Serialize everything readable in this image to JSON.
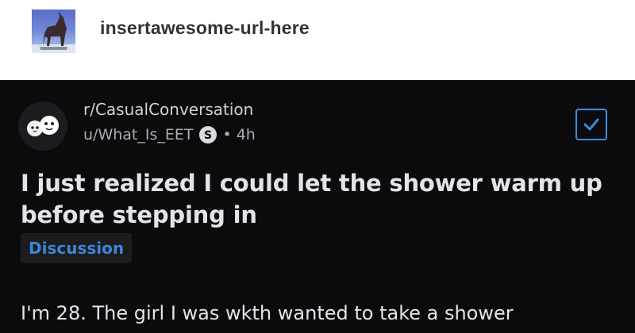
{
  "tumblr": {
    "blog_name": "insertawesome-url-here",
    "avatar_icon": "dog-on-rock-avatar-icon"
  },
  "post": {
    "subreddit": "r/CasualConversation",
    "username": "u/What_Is_EET",
    "separator": "•",
    "time_ago": "4h",
    "title": "I just realized I could let the shower warm up before stepping in",
    "flair": "Discussion",
    "body_preview": "I'm 28. The girl I was wkth wanted to take a shower"
  },
  "colors": {
    "card_bg": "#0b0b0d",
    "flair_text": "#3b86d6",
    "checkbox_accent": "#3a8dde"
  }
}
